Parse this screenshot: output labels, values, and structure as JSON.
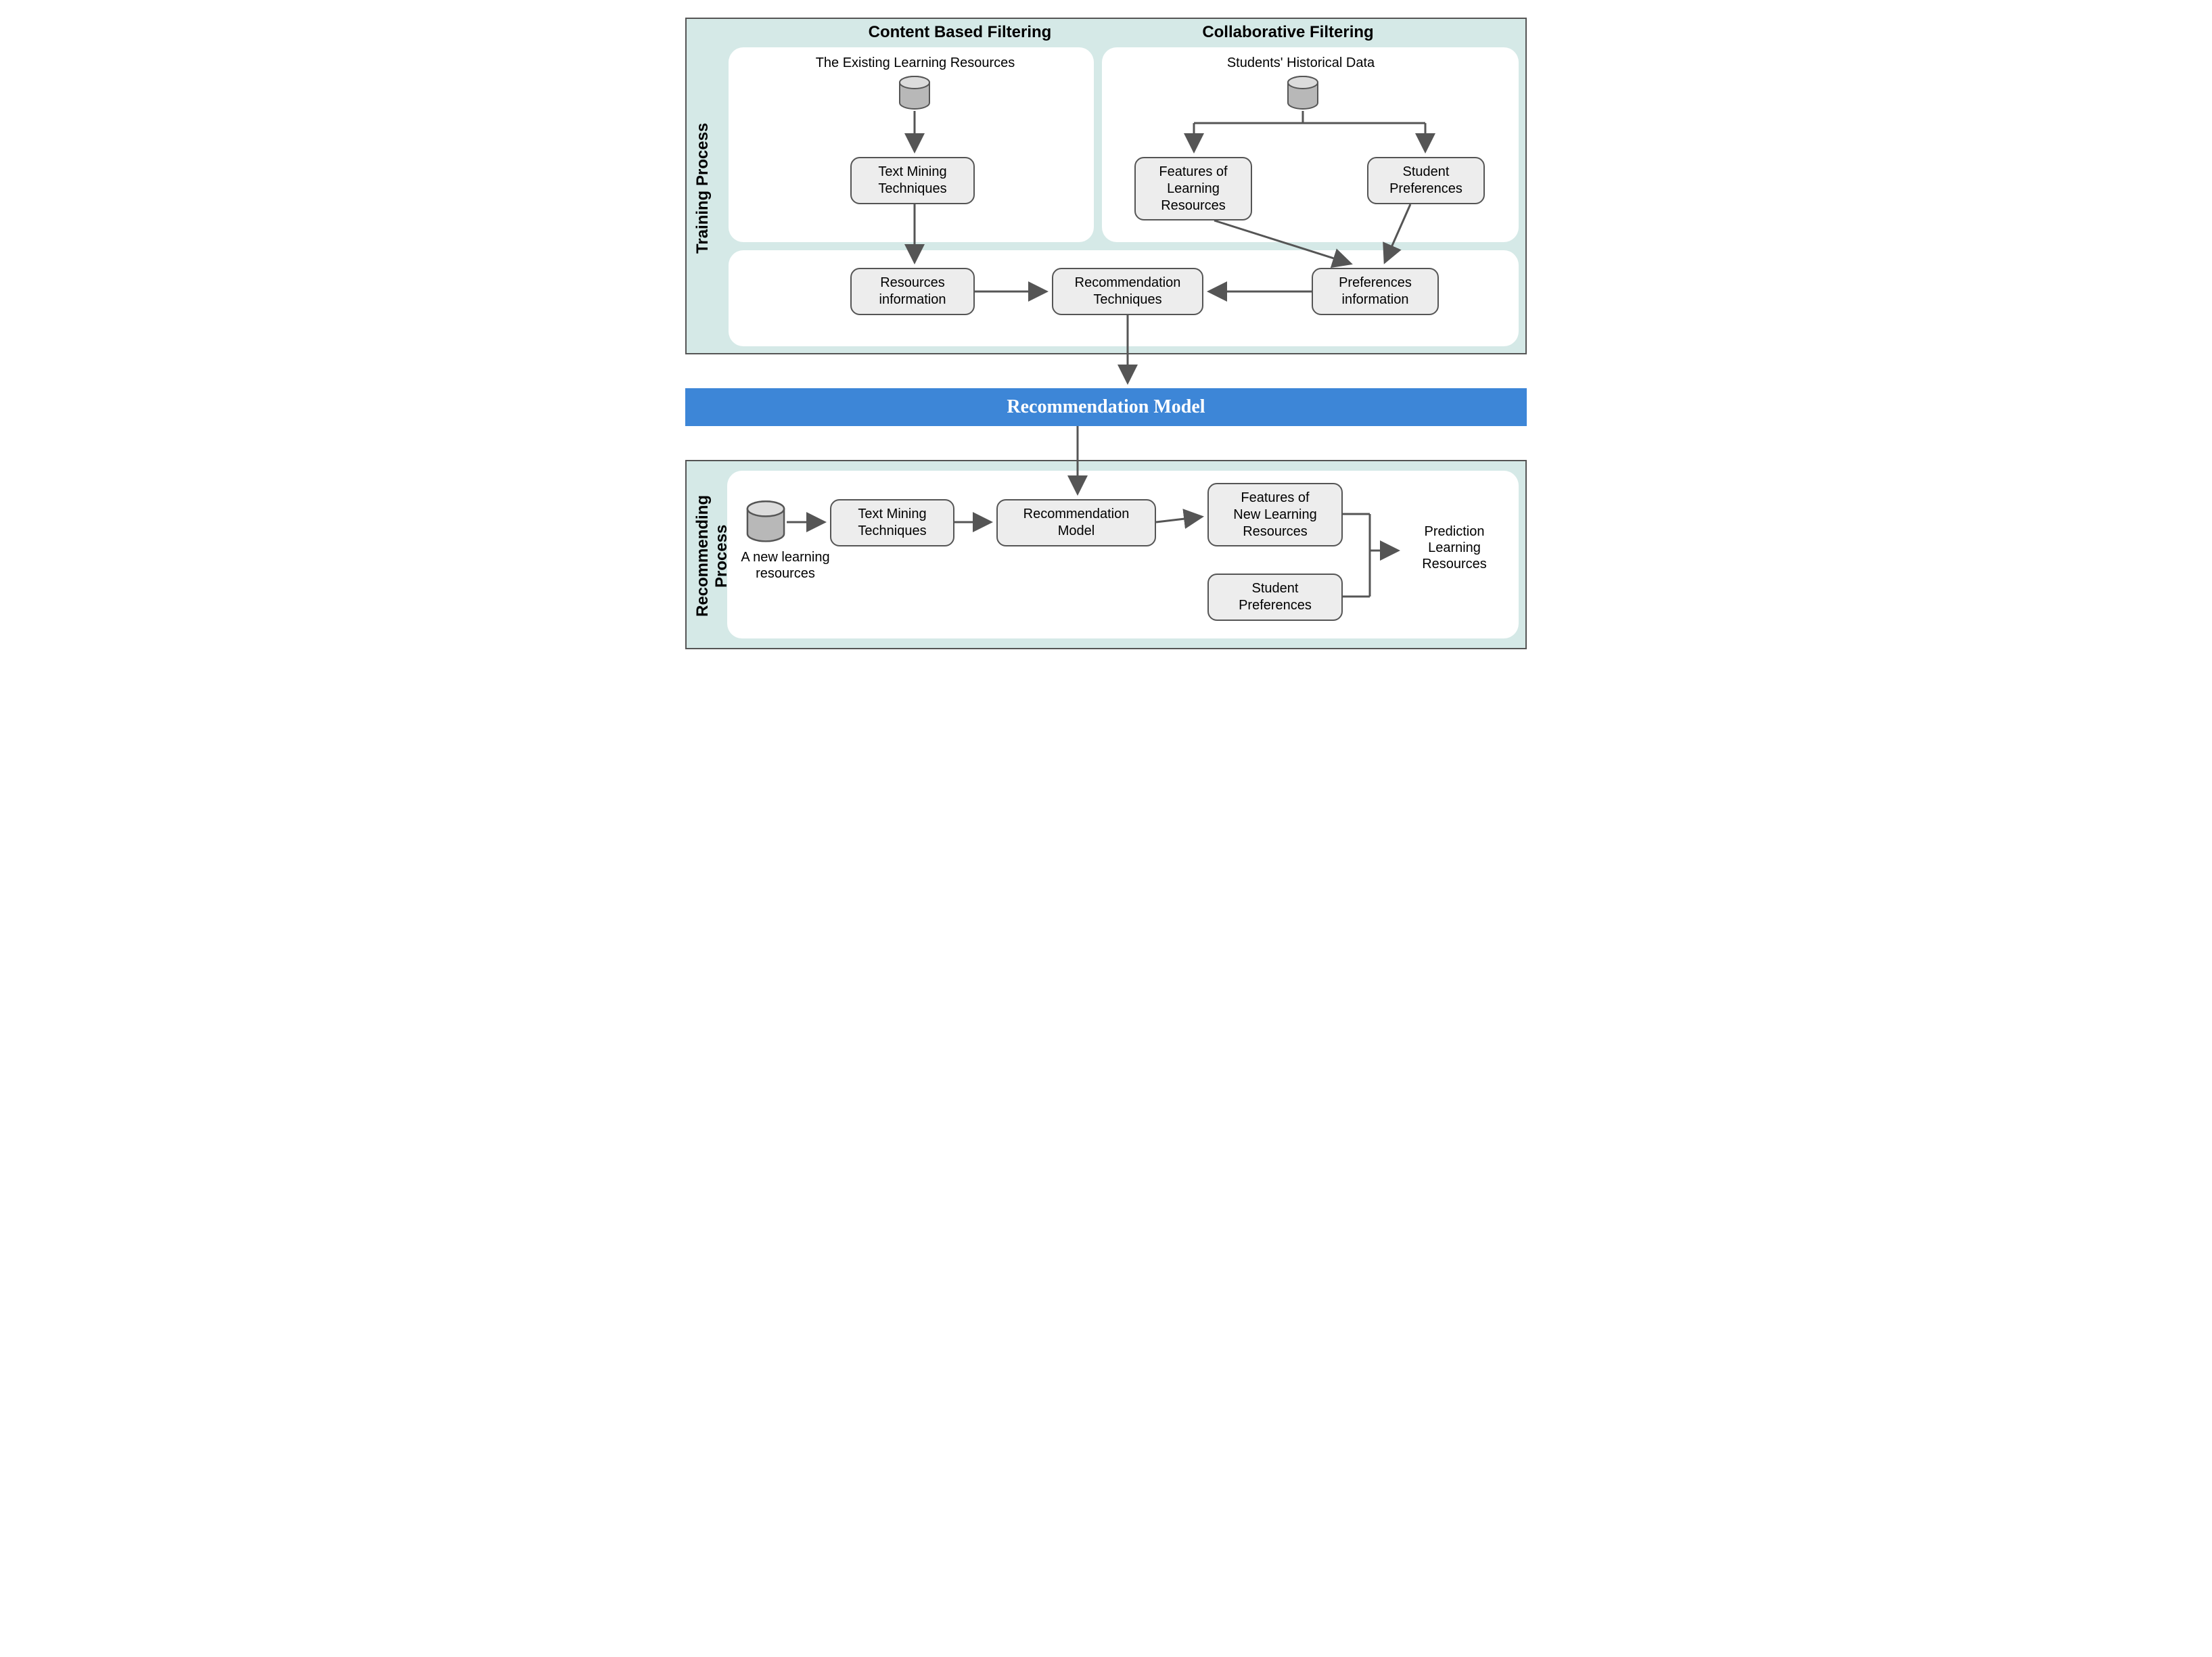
{
  "training": {
    "label": "Training Process",
    "content_based": {
      "title": "Content Based Filtering",
      "resources_label": "The Existing  Learning Resources",
      "text_mining": "Text Mining\nTechniques"
    },
    "collaborative": {
      "title": "Collaborative Filtering",
      "historical_label": "Students' Historical Data",
      "features": "Features of\nLearning\nResources",
      "preferences": "Student\nPreferences"
    },
    "middle": {
      "resources_info": "Resources\ninformation",
      "recommendation_techniques": "Recommendation\nTechniques",
      "preferences_info": "Preferences\ninformation"
    }
  },
  "model_bar": "Recommendation Model",
  "recommending": {
    "label": "Recommending\nProcess",
    "new_resources_label": "A new learning\nresources",
    "text_mining": "Text Mining\nTechniques",
    "rec_model": "Recommendation\nModel",
    "features_new": "Features of\nNew Learning\nResources",
    "student_prefs": "Student\nPreferences",
    "prediction": "Prediction\nLearning\nResources"
  }
}
